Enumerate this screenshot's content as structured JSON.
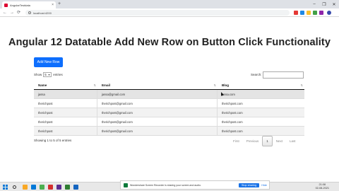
{
  "browser": {
    "tab_title": "AngularTestdata",
    "tab_close": "×",
    "new_tab": "+",
    "url": "localhost:4200",
    "window_controls": [
      "–",
      "❐",
      "✕"
    ],
    "nav": {
      "back": "←",
      "forward": "→",
      "reload": "⟳"
    },
    "extension_colors": [
      "#e53935",
      "#1e88e5",
      "#fbc02d",
      "#43a047",
      "#8e24aa",
      "#3949ab"
    ]
  },
  "page": {
    "title": "Angular 12 Datatable Add New Row on Button Click Functionality",
    "add_button": "Add New Row"
  },
  "datatable": {
    "show_label": "Show",
    "length_value": "5",
    "entries_label": "entries",
    "search_label": "Search:",
    "columns": [
      "Name",
      "Email",
      "Blog"
    ],
    "rows": [
      [
        "jassa",
        "jassa@gmail.com",
        "jassa.com"
      ],
      [
        "therichpost",
        "therichpost@gmail.com",
        "therichpost.com"
      ],
      [
        "therichpost",
        "therichpost@gmail.com",
        "therichpost.com"
      ],
      [
        "therichpost",
        "therichpost@gmail.com",
        "therichpost.com"
      ],
      [
        "therichpost",
        "therichpost@gmail.com",
        "therichpost.com"
      ]
    ],
    "info": "Showing 1 to 5 of 5 entries",
    "pager": {
      "first": "First",
      "previous": "Previous",
      "page": "1",
      "next": "Next",
      "last": "Last"
    }
  },
  "notification": {
    "text": "Wondershare Screen Recorder is sharing your screen and audio.",
    "stop_label": "Stop sharing",
    "hide_label": "Hide"
  },
  "taskbar": {
    "app_colors": [
      "#f9a825",
      "#0078d7",
      "#4caf50",
      "#d32f2f",
      "#5c2d91",
      "#2e7d32",
      "#1565c0"
    ],
    "time": "21:08",
    "date": "02-08-2021"
  }
}
